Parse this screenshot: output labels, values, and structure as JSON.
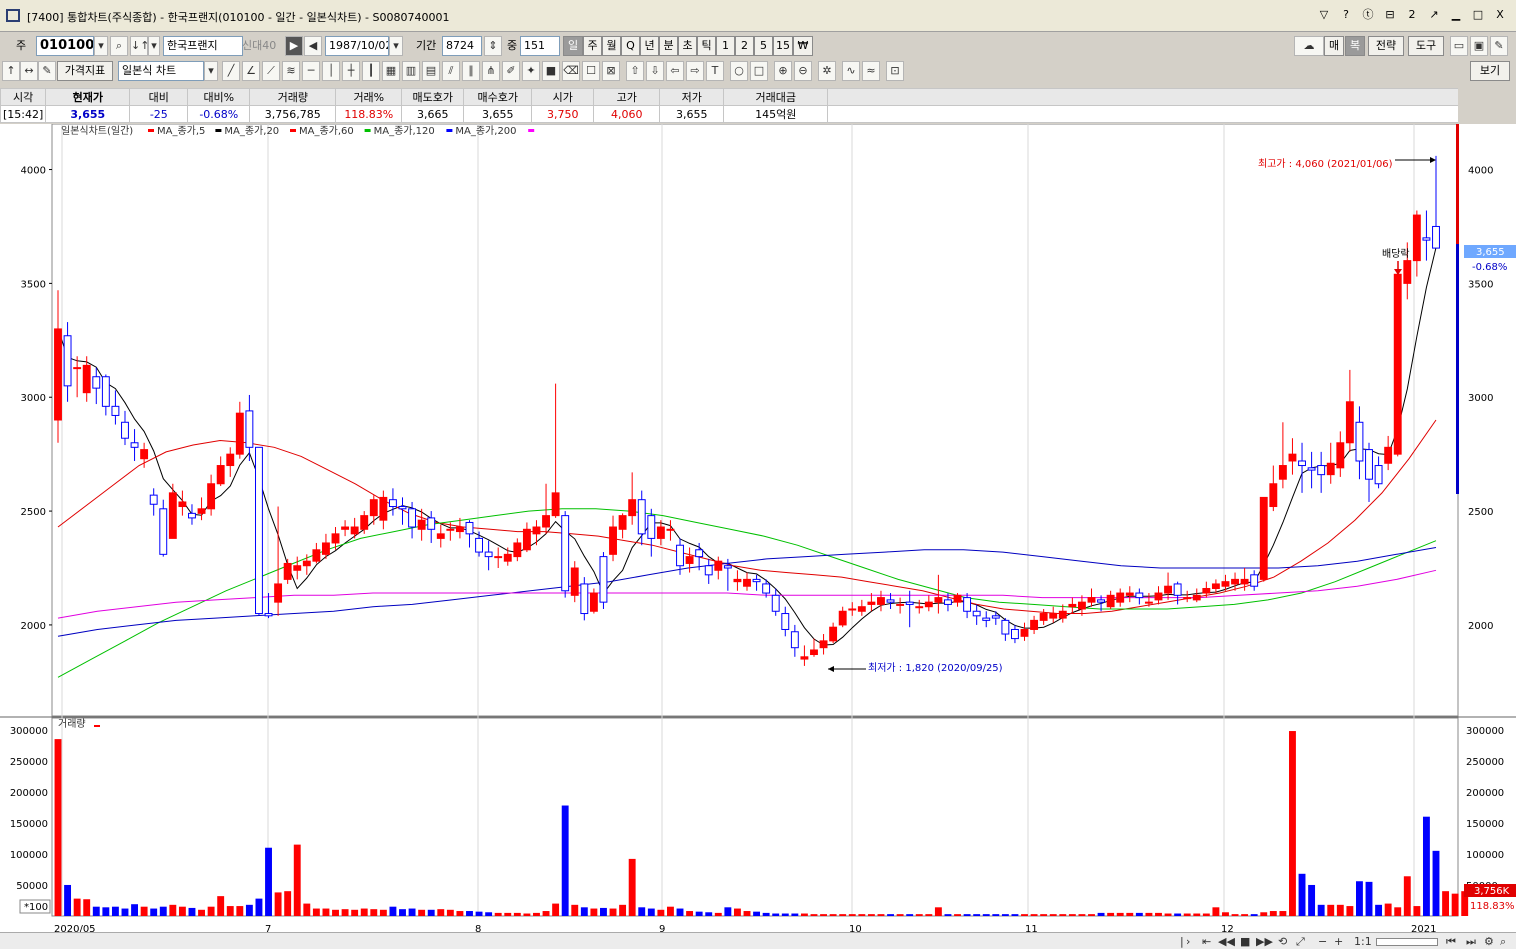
{
  "window": {
    "title": "[7400]  통합차트(주식종합)  -  한국프랜지(010100 - 일간 - 일본식차트) - S0080740001",
    "controls": [
      "▽",
      "?",
      "ⓣ",
      "⊟",
      "2",
      "↗",
      "▁",
      "□",
      "X"
    ]
  },
  "toolbar1": {
    "code_prefix": "주",
    "code": "010100",
    "name": "한국프랜지",
    "badge": "신대40",
    "date": "1987/10/02",
    "period_label": "기간",
    "period": "8724",
    "zoom_label": "중",
    "zoom": "151",
    "periods": [
      "일",
      "주",
      "월",
      "Q",
      "년",
      "분",
      "초",
      "틱",
      "1",
      "2",
      "5",
      "15",
      "₩"
    ],
    "right_buttons": [
      "매",
      "복",
      "전략",
      "도구"
    ]
  },
  "toolbar2": {
    "indicator_label": "가격지표",
    "chart_type": "일본식 차트",
    "view_button": "보기"
  },
  "quote": {
    "headers": [
      "시각",
      "현재가",
      "대비",
      "대비%",
      "거래량",
      "거래%",
      "매도호가",
      "매수호가",
      "시가",
      "고가",
      "저가",
      "거래대금"
    ],
    "values": [
      "[15:42]",
      "3,655",
      "-25",
      "-0.68%",
      "3,756,785",
      "118.83%",
      "3,665",
      "3,655",
      "3,750",
      "4,060",
      "3,655",
      "145억원"
    ]
  },
  "legend": {
    "title": "일본식차트(일간)",
    "items": [
      {
        "label": "MA_종가,5",
        "color": "#ff0000"
      },
      {
        "label": "MA_종가,20",
        "color": "#000000"
      },
      {
        "label": "MA_종가,60",
        "color": "#ff0000"
      },
      {
        "label": "MA_종가,120",
        "color": "#00c000"
      },
      {
        "label": "MA_종가,200",
        "color": "#0000ff"
      },
      {
        "label": "",
        "color": "#ff00ff"
      }
    ]
  },
  "volume_legend": {
    "title": "거래량"
  },
  "annotations": {
    "high": "최고가 : 4,060 (2021/01/06)",
    "low": "최저가 : 1,820 (2020/09/25)",
    "event": "배당락",
    "price_tag": "3,655",
    "pct_tag": "-0.68%",
    "vol_tag": "3,756K",
    "vol_pct_tag": "118.83%",
    "vol_unit": "*100"
  },
  "statusbar": {
    "ratio": "1:1"
  },
  "chart_data": {
    "type": "candlestick",
    "price_axis": {
      "min": 1600,
      "max": 4200,
      "ticks": [
        "4000",
        "3500",
        "3000",
        "2500",
        "2000"
      ]
    },
    "volume_axis": {
      "min": 0,
      "max": 300000,
      "ticks": [
        "300000",
        "250000",
        "200000",
        "150000",
        "100000",
        "50000"
      ]
    },
    "x_labels": [
      "2020/05",
      "7",
      "8",
      "9",
      "10",
      "11",
      "12",
      "2021"
    ],
    "candles": [
      [
        2900,
        3300,
        3470,
        2800
      ],
      [
        3270,
        3050,
        3330,
        2980
      ],
      [
        3130,
        3130,
        3180,
        3000
      ],
      [
        3020,
        3140,
        3180,
        2980
      ],
      [
        3090,
        3040,
        3130,
        2970
      ],
      [
        3090,
        2960,
        3100,
        2920
      ],
      [
        2960,
        2920,
        3030,
        2880
      ],
      [
        2890,
        2820,
        2940,
        2790
      ],
      [
        2800,
        2780,
        2860,
        2720
      ],
      [
        2730,
        2770,
        2800,
        2690
      ],
      [
        2570,
        2530,
        2600,
        2480
      ],
      [
        2510,
        2310,
        2550,
        2300
      ],
      [
        2380,
        2580,
        2620,
        2380
      ],
      [
        2520,
        2540,
        2590,
        2480
      ],
      [
        2490,
        2470,
        2530,
        2440
      ],
      [
        2490,
        2510,
        2560,
        2460
      ],
      [
        2510,
        2620,
        2660,
        2480
      ],
      [
        2620,
        2700,
        2740,
        2610
      ],
      [
        2700,
        2750,
        2780,
        2650
      ],
      [
        2750,
        2930,
        2980,
        2730
      ],
      [
        2940,
        2780,
        3010,
        2720
      ],
      [
        2780,
        2050,
        2770,
        2040
      ],
      [
        2050,
        2040,
        2140,
        2030
      ],
      [
        2100,
        2180,
        2520,
        2040
      ],
      [
        2200,
        2270,
        2290,
        2180
      ],
      [
        2240,
        2260,
        2300,
        2200
      ],
      [
        2260,
        2280,
        2310,
        2220
      ],
      [
        2280,
        2330,
        2360,
        2270
      ],
      [
        2310,
        2360,
        2400,
        2290
      ],
      [
        2360,
        2400,
        2430,
        2330
      ],
      [
        2420,
        2430,
        2460,
        2390
      ],
      [
        2400,
        2430,
        2470,
        2380
      ],
      [
        2420,
        2480,
        2500,
        2400
      ],
      [
        2480,
        2550,
        2570,
        2440
      ],
      [
        2460,
        2560,
        2590,
        2420
      ],
      [
        2550,
        2520,
        2600,
        2480
      ],
      [
        2520,
        2510,
        2560,
        2440
      ],
      [
        2510,
        2430,
        2540,
        2380
      ],
      [
        2420,
        2460,
        2510,
        2370
      ],
      [
        2470,
        2420,
        2500,
        2360
      ],
      [
        2380,
        2400,
        2440,
        2340
      ],
      [
        2420,
        2420,
        2450,
        2370
      ],
      [
        2410,
        2430,
        2470,
        2380
      ],
      [
        2450,
        2400,
        2460,
        2340
      ],
      [
        2380,
        2320,
        2410,
        2300
      ],
      [
        2320,
        2300,
        2370,
        2240
      ],
      [
        2300,
        2300,
        2340,
        2250
      ],
      [
        2280,
        2310,
        2340,
        2260
      ],
      [
        2300,
        2360,
        2380,
        2280
      ],
      [
        2330,
        2420,
        2450,
        2320
      ],
      [
        2400,
        2430,
        2460,
        2350
      ],
      [
        2430,
        2480,
        2620,
        2400
      ],
      [
        2480,
        2580,
        3060,
        2470
      ],
      [
        2480,
        2150,
        2500,
        2120
      ],
      [
        2130,
        2250,
        2280,
        2100
      ],
      [
        2180,
        2050,
        2210,
        2020
      ],
      [
        2060,
        2140,
        2160,
        2050
      ],
      [
        2300,
        2100,
        2320,
        2070
      ],
      [
        2310,
        2430,
        2480,
        2280
      ],
      [
        2420,
        2480,
        2490,
        2380
      ],
      [
        2480,
        2550,
        2670,
        2440
      ],
      [
        2550,
        2400,
        2590,
        2350
      ],
      [
        2480,
        2380,
        2510,
        2300
      ],
      [
        2380,
        2430,
        2460,
        2350
      ],
      [
        2420,
        2420,
        2460,
        2370
      ],
      [
        2350,
        2260,
        2380,
        2220
      ],
      [
        2270,
        2300,
        2340,
        2230
      ],
      [
        2330,
        2300,
        2360,
        2240
      ],
      [
        2260,
        2220,
        2290,
        2180
      ],
      [
        2240,
        2280,
        2300,
        2200
      ],
      [
        2260,
        2250,
        2290,
        2150
      ],
      [
        2190,
        2200,
        2240,
        2150
      ],
      [
        2170,
        2200,
        2230,
        2150
      ],
      [
        2200,
        2190,
        2220,
        2150
      ],
      [
        2180,
        2140,
        2200,
        2120
      ],
      [
        2130,
        2060,
        2160,
        2040
      ],
      [
        2050,
        1980,
        2080,
        1950
      ],
      [
        1970,
        1900,
        2000,
        1860
      ],
      [
        1850,
        1860,
        1910,
        1820
      ],
      [
        1870,
        1890,
        1940,
        1860
      ],
      [
        1900,
        1930,
        1960,
        1870
      ],
      [
        1930,
        1990,
        2010,
        1920
      ],
      [
        2000,
        2060,
        2080,
        1990
      ],
      [
        2070,
        2070,
        2100,
        2040
      ],
      [
        2060,
        2080,
        2110,
        2040
      ],
      [
        2090,
        2100,
        2140,
        2060
      ],
      [
        2090,
        2120,
        2150,
        2060
      ],
      [
        2110,
        2100,
        2140,
        2070
      ],
      [
        2090,
        2090,
        2120,
        2050
      ],
      [
        2100,
        2090,
        2150,
        1990
      ],
      [
        2080,
        2080,
        2110,
        2050
      ],
      [
        2080,
        2100,
        2130,
        2060
      ],
      [
        2100,
        2120,
        2220,
        2050
      ],
      [
        2110,
        2090,
        2140,
        2060
      ],
      [
        2100,
        2130,
        2140,
        2080
      ],
      [
        2120,
        2060,
        2140,
        2030
      ],
      [
        2060,
        2040,
        2090,
        2000
      ],
      [
        2030,
        2020,
        2060,
        1990
      ],
      [
        2040,
        2030,
        2060,
        2000
      ],
      [
        2020,
        1960,
        2030,
        1930
      ],
      [
        1980,
        1940,
        2000,
        1920
      ],
      [
        1950,
        1980,
        2010,
        1930
      ],
      [
        1980,
        2020,
        2040,
        1960
      ],
      [
        2020,
        2050,
        2070,
        2000
      ],
      [
        2030,
        2050,
        2080,
        2010
      ],
      [
        2030,
        2060,
        2090,
        2010
      ],
      [
        2080,
        2090,
        2120,
        2050
      ],
      [
        2070,
        2100,
        2130,
        2040
      ],
      [
        2100,
        2120,
        2160,
        2080
      ],
      [
        2110,
        2100,
        2130,
        2060
      ],
      [
        2080,
        2130,
        2150,
        2070
      ],
      [
        2100,
        2140,
        2160,
        2080
      ],
      [
        2130,
        2140,
        2170,
        2100
      ],
      [
        2140,
        2120,
        2160,
        2090
      ],
      [
        2100,
        2100,
        2140,
        2080
      ],
      [
        2110,
        2140,
        2170,
        2090
      ],
      [
        2140,
        2170,
        2230,
        2110
      ],
      [
        2180,
        2130,
        2190,
        2090
      ],
      [
        2120,
        2120,
        2150,
        2100
      ],
      [
        2110,
        2130,
        2160,
        2100
      ],
      [
        2140,
        2160,
        2190,
        2120
      ],
      [
        2160,
        2180,
        2200,
        2140
      ],
      [
        2170,
        2190,
        2220,
        2150
      ],
      [
        2180,
        2200,
        2230,
        2150
      ],
      [
        2180,
        2200,
        2250,
        2150
      ],
      [
        2220,
        2170,
        2240,
        2150
      ],
      [
        2200,
        2560,
        2560,
        2190
      ],
      [
        2520,
        2620,
        2700,
        2500
      ],
      [
        2640,
        2700,
        2890,
        2600
      ],
      [
        2720,
        2750,
        2820,
        2660
      ],
      [
        2720,
        2700,
        2800,
        2580
      ],
      [
        2690,
        2680,
        2760,
        2600
      ],
      [
        2700,
        2660,
        2760,
        2580
      ],
      [
        2660,
        2710,
        2800,
        2620
      ],
      [
        2690,
        2800,
        2850,
        2650
      ],
      [
        2800,
        2980,
        3120,
        2760
      ],
      [
        2890,
        2720,
        2960,
        2640
      ],
      [
        2770,
        2640,
        2800,
        2540
      ],
      [
        2700,
        2620,
        2740,
        2600
      ],
      [
        2710,
        2780,
        2830,
        2680
      ],
      [
        2750,
        3540,
        3560,
        2740
      ],
      [
        3500,
        3600,
        3680,
        3430
      ],
      [
        3600,
        3800,
        3820,
        3530
      ],
      [
        3700,
        3690,
        3820,
        3600
      ],
      [
        3750,
        3655,
        4060,
        3655
      ]
    ],
    "volumes": [
      285000,
      50000,
      28000,
      27000,
      15000,
      14000,
      15000,
      12000,
      19000,
      15000,
      12000,
      15000,
      18000,
      15000,
      13000,
      10000,
      15000,
      32000,
      16000,
      16000,
      18000,
      28000,
      110000,
      38000,
      40000,
      115000,
      20000,
      12000,
      12000,
      10000,
      11000,
      10000,
      12000,
      11000,
      10000,
      15000,
      11000,
      12000,
      10000,
      10000,
      11000,
      10000,
      8000,
      8000,
      7000,
      6000,
      5000,
      5000,
      5000,
      4000,
      5000,
      8000,
      20000,
      178000,
      18000,
      14000,
      12000,
      13000,
      12000,
      18000,
      92000,
      14000,
      12000,
      10000,
      15000,
      12000,
      8000,
      7000,
      6000,
      5000,
      14000,
      12000,
      8000,
      7000,
      5000,
      4000,
      4000,
      4000,
      4000,
      3000,
      3000,
      3000,
      3000,
      3000,
      3000,
      3000,
      3000,
      3000,
      3000,
      3000,
      3000,
      3000,
      14000,
      3000,
      3000,
      3000,
      3000,
      3000,
      3000,
      3000,
      3000,
      3000,
      3000,
      3000,
      3000,
      3000,
      3000,
      3000,
      3000,
      5000,
      5000,
      5000,
      5000,
      5000,
      5000,
      5000,
      4000,
      4000,
      4000,
      4000,
      4000,
      14000,
      6000,
      3000,
      3000,
      3000,
      6000,
      8000,
      8000,
      298000,
      68000,
      50000,
      18000,
      18000,
      18000,
      16000,
      56000,
      55000,
      18000,
      20000,
      14000,
      64000,
      16000,
      160000,
      105000,
      40000,
      36000,
      40000
    ],
    "ma_labels": [
      "MA_종가,5",
      "MA_종가,20",
      "MA_종가,60",
      "MA_종가,120",
      "MA_종가,200"
    ],
    "ma60": [
      2430,
      2520,
      2610,
      2700,
      2760,
      2790,
      2810,
      2800,
      2780,
      2740,
      2680,
      2620,
      2550,
      2490,
      2450,
      2430,
      2420,
      2410,
      2410,
      2400,
      2390,
      2370,
      2350,
      2320,
      2290,
      2260,
      2240,
      2230,
      2220,
      2210,
      2190,
      2170,
      2150,
      2120,
      2090,
      2070,
      2060,
      2050,
      2050,
      2060,
      2080,
      2100,
      2120,
      2140,
      2170,
      2210,
      2280,
      2360,
      2460,
      2580,
      2730,
      2900
    ],
    "ma120": [
      1770,
      1850,
      1930,
      2010,
      2080,
      2150,
      2210,
      2270,
      2330,
      2380,
      2410,
      2440,
      2460,
      2480,
      2500,
      2510,
      2510,
      2500,
      2480,
      2450,
      2420,
      2390,
      2350,
      2300,
      2250,
      2200,
      2160,
      2120,
      2100,
      2090,
      2080,
      2070,
      2070,
      2070,
      2080,
      2090,
      2110,
      2140,
      2190,
      2250,
      2310,
      2370
    ],
    "ma200": [
      1950,
      1980,
      2000,
      2020,
      2030,
      2040,
      2050,
      2060,
      2080,
      2090,
      2110,
      2130,
      2150,
      2170,
      2190,
      2220,
      2250,
      2270,
      2290,
      2300,
      2310,
      2320,
      2330,
      2330,
      2320,
      2300,
      2280,
      2260,
      2250,
      2250,
      2250,
      2250,
      2260,
      2280,
      2310,
      2340
    ],
    "ma_pink": [
      2030,
      2060,
      2080,
      2100,
      2110,
      2120,
      2130,
      2130,
      2140,
      2140,
      2140,
      2140,
      2140,
      2140,
      2140,
      2140,
      2140,
      2140,
      2130,
      2130,
      2130,
      2130,
      2130,
      2130,
      2130,
      2120,
      2120,
      2120,
      2120,
      2120,
      2130,
      2140,
      2150,
      2170,
      2200,
      2240
    ]
  }
}
